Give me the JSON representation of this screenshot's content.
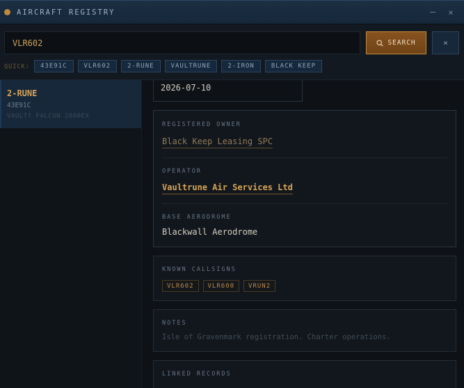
{
  "window": {
    "title": "AIRCRAFT REGISTRY",
    "minimize_glyph": "—",
    "close_glyph": "×"
  },
  "search": {
    "value": "VLR602",
    "button_label": "SEARCH",
    "clear_glyph": "×",
    "quick_label": "QUICK:",
    "quick": [
      "43E91C",
      "VLR602",
      "2-RUNE",
      "VAULTRUNE",
      "2-IRON",
      "BLACK KEEP"
    ]
  },
  "results": [
    {
      "title": "2-RUNE",
      "subtitle": "43E91C",
      "meta": "VAULT? FALCON 2000EX"
    }
  ],
  "detail": {
    "date": "2026-07-10",
    "registered_owner": {
      "label": "REGISTERED OWNER",
      "value": "Black Keep Leasing SPC"
    },
    "operator": {
      "label": "OPERATOR",
      "value": "Vaultrune Air Services Ltd"
    },
    "base": {
      "label": "BASE AERODROME",
      "value": "Blackwall Aerodrome"
    },
    "callsigns": {
      "label": "KNOWN CALLSIGNS",
      "items": [
        "VLR602",
        "VLR600",
        "VRUN2"
      ]
    },
    "notes": {
      "label": "NOTES",
      "text": "Isle of Gravenmark registration. Charter operations."
    },
    "linked": {
      "label": "LINKED RECORDS"
    }
  },
  "icons": {
    "app": "status-dot-icon",
    "search": "search-icon"
  },
  "colors": {
    "accent": "#d6a255",
    "panel": "#12171d",
    "chip": "#15283c"
  }
}
